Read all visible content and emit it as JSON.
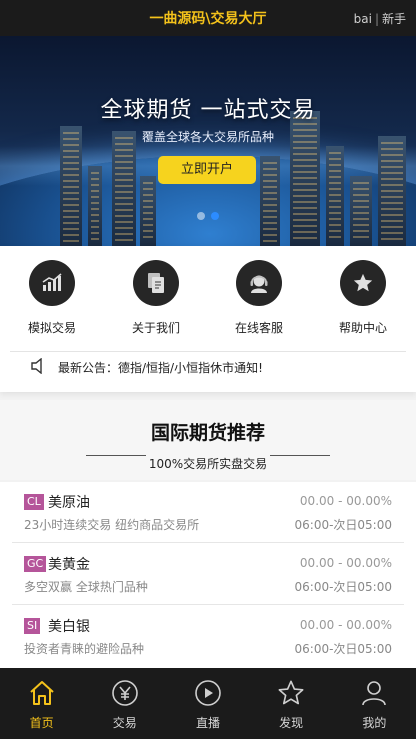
{
  "header": {
    "title": "一曲源码\\交易大厅",
    "login_label": "bai",
    "separator": "|",
    "register_label": "新手"
  },
  "banner": {
    "headline": "全球期货 一站式交易",
    "subline": "覆盖全球各大交易所品种",
    "cta_label": "立即开户",
    "slide_count": 2,
    "active_slide": 1
  },
  "quick_links": [
    {
      "label": "模拟交易",
      "icon": "chart-up-icon"
    },
    {
      "label": "关于我们",
      "icon": "documents-icon"
    },
    {
      "label": "在线客服",
      "icon": "support-agent-icon"
    },
    {
      "label": "帮助中心",
      "icon": "star-icon"
    }
  ],
  "notice": {
    "prefix": "最新公告：",
    "text": "德指/恒指/小恒指休市通知!"
  },
  "section": {
    "title": "国际期货推荐",
    "subtitle": "100%交易所实盘交易"
  },
  "products": [
    {
      "code": "CL",
      "name": "美原油",
      "desc": "23小时连续交易 纽约商品交易所",
      "price": "00.00 - 00.00%",
      "hours": "06:00-次日05:00"
    },
    {
      "code": "GC",
      "name": "美黄金",
      "desc": "多空双赢 全球热门品种",
      "price": "00.00 - 00.00%",
      "hours": "06:00-次日05:00"
    },
    {
      "code": "SI",
      "name": "美白银",
      "desc": "投资者青睐的避险品种",
      "price": "00.00 - 00.00%",
      "hours": "06:00-次日05:00"
    }
  ],
  "tabs": [
    {
      "label": "首页",
      "icon": "home-icon",
      "active": true
    },
    {
      "label": "交易",
      "icon": "yen-icon",
      "active": false
    },
    {
      "label": "直播",
      "icon": "play-icon",
      "active": false
    },
    {
      "label": "发现",
      "icon": "star-outline-icon",
      "active": false
    },
    {
      "label": "我的",
      "icon": "user-icon",
      "active": false
    }
  ],
  "colors": {
    "accent": "#f4c21b",
    "tag": "#b5559a",
    "dark_bar": "#1b1b1b"
  }
}
